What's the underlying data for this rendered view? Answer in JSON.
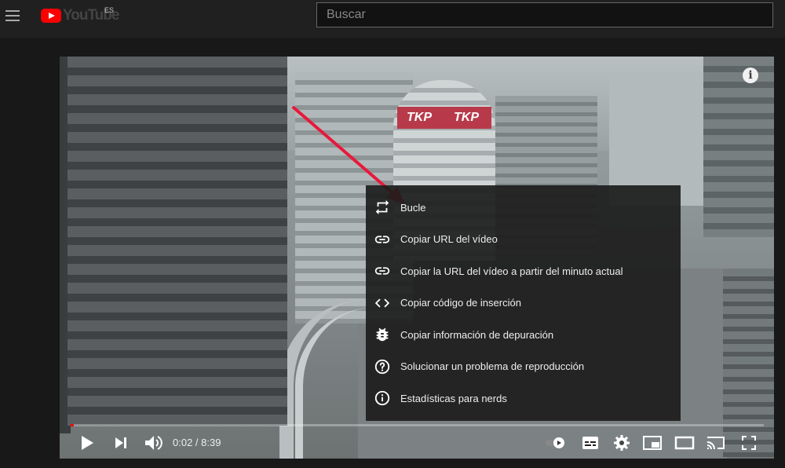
{
  "header": {
    "logo_text": "YouTube",
    "country_code": "ES",
    "search_placeholder": "Buscar"
  },
  "context_menu": {
    "items": [
      {
        "label": "Bucle",
        "icon": "loop-icon"
      },
      {
        "label": "Copiar URL del vídeo",
        "icon": "link-icon"
      },
      {
        "label": "Copiar la URL del vídeo a partir del minuto actual",
        "icon": "link-icon"
      },
      {
        "label": "Copiar código de inserción",
        "icon": "code-icon"
      },
      {
        "label": "Copiar información de depuración",
        "icon": "bug-icon"
      },
      {
        "label": "Solucionar un problema de reproducción",
        "icon": "help-icon"
      },
      {
        "label": "Estadísticas para nerds",
        "icon": "info-icon"
      }
    ]
  },
  "video": {
    "sign_text": "TKP",
    "sign_text_2": "TKP",
    "time_display": "0:02 / 8:39",
    "progress_fraction": 0.004
  },
  "colors": {
    "accent": "#ff0000",
    "annotation_arrow": "#e8193c"
  }
}
